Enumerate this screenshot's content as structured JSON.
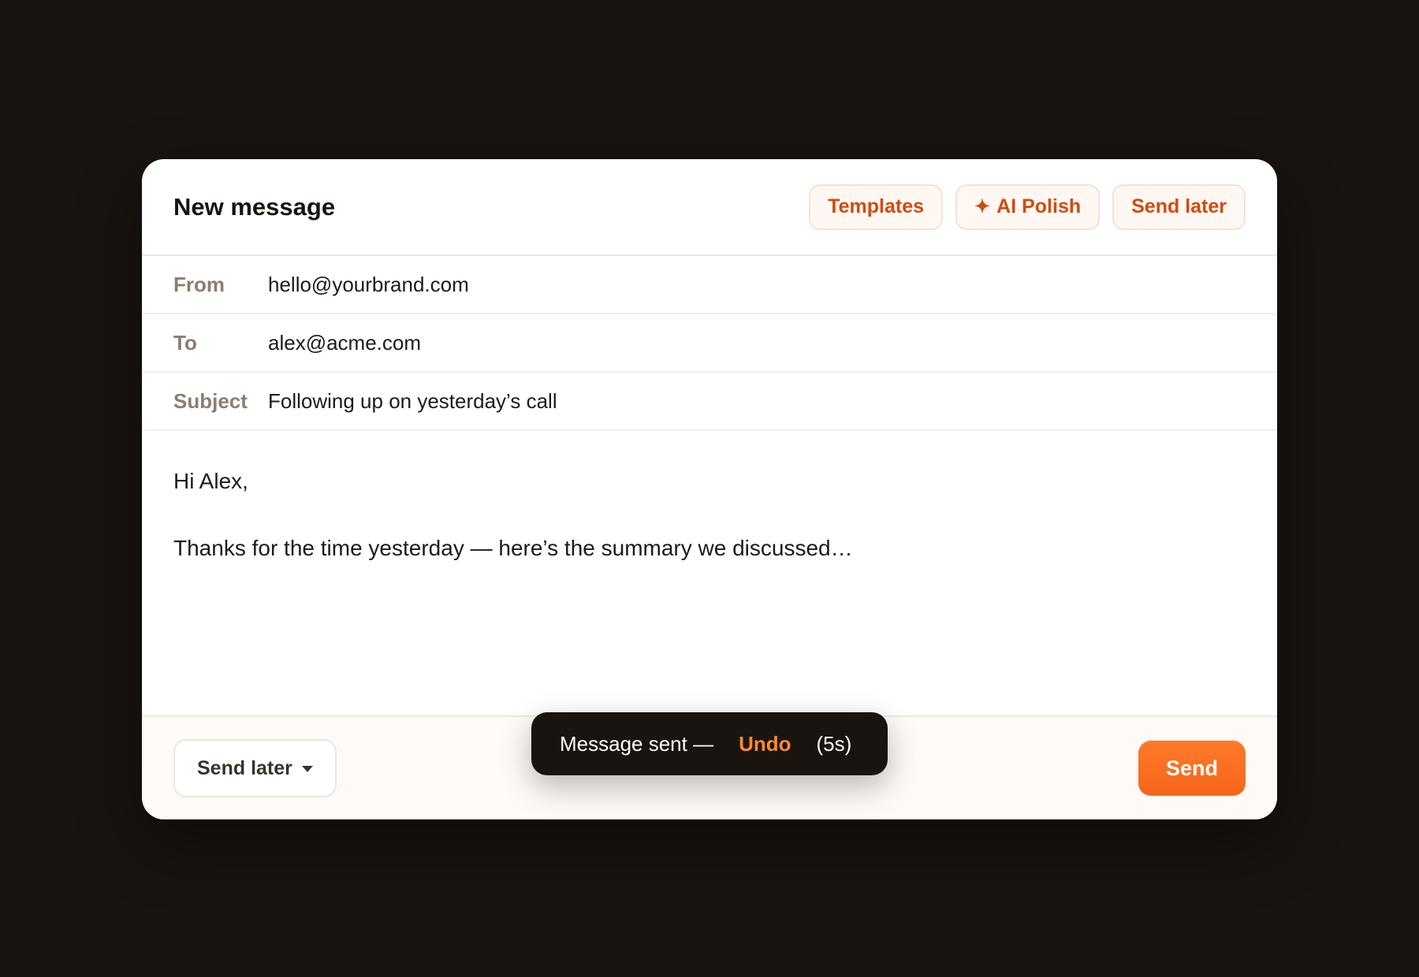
{
  "window": {
    "title": "New message"
  },
  "header": {
    "actions": [
      {
        "label": "Templates",
        "icon": ""
      },
      {
        "label": "AI Polish",
        "icon": "sparkle-icon"
      },
      {
        "label": "Send later",
        "icon": ""
      }
    ]
  },
  "fields": {
    "from": {
      "label": "From",
      "value": "hello@yourbrand.com"
    },
    "to": {
      "label": "To",
      "value": "alex@acme.com"
    },
    "subject": {
      "label": "Subject",
      "value": "Following up on yesterday’s call"
    }
  },
  "body": {
    "greeting": "Hi Alex,",
    "line1": "Thanks for the time yesterday — here’s the summary we discussed…"
  },
  "footer": {
    "send_later_label": "Send later",
    "send_label": "Send"
  },
  "toast": {
    "message": "Message sent —",
    "undo_label": "Undo",
    "countdown": "(5s)"
  },
  "colors": {
    "accent": "#f5651a",
    "accent_text": "#d24a0e",
    "background": "#1a1410",
    "undo": "#ff8a2e"
  }
}
